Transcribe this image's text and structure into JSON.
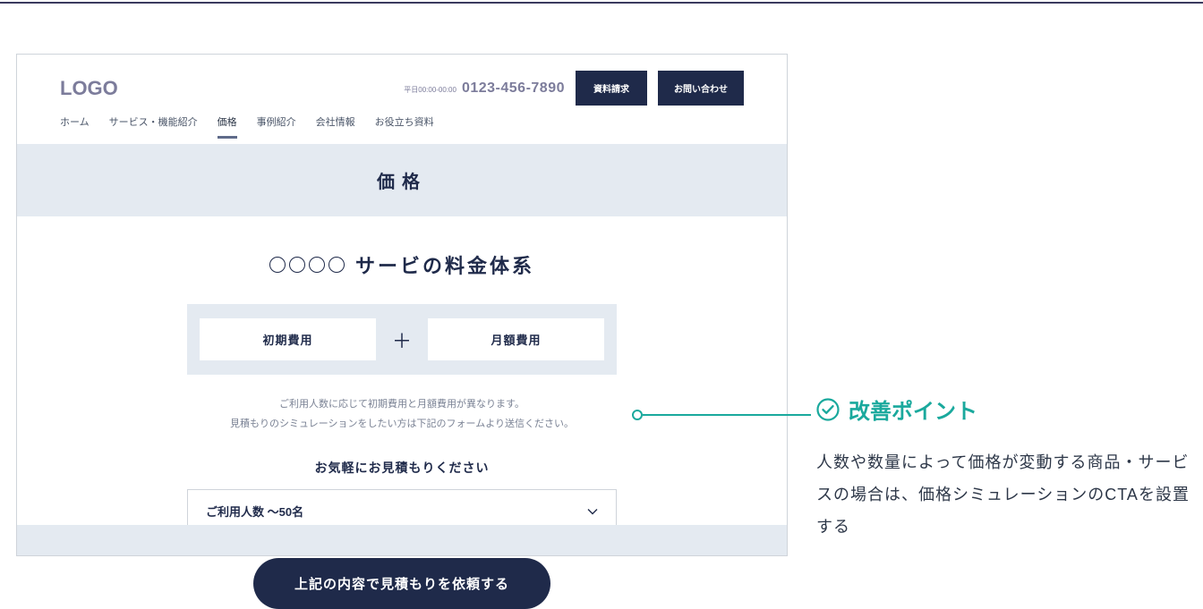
{
  "header": {
    "logo": "LOGO",
    "phone_hours": "平日00:00-00:00",
    "phone_number": "0123-456-7890",
    "btn_request": "資料請求",
    "btn_contact": "お問い合わせ"
  },
  "nav": {
    "items": [
      "ホーム",
      "サービス・機能紹介",
      "価格",
      "事例紹介",
      "会社情報",
      "お役立ち資料"
    ],
    "active_index": 2
  },
  "page_title": "価格",
  "section": {
    "title_text": "サービの料金体系",
    "fee_initial": "初期費用",
    "fee_monthly": "月額費用",
    "desc_line1": "ご利用人数に応じて初期費用と月額費用が異なります。",
    "desc_line2": "見積もりのシミュレーションをしたい方は下記のフォームより送信ください。",
    "sub_heading": "お気軽にお見積もりください",
    "select_label": "ご利用人数  〜50名",
    "cta_label": "上記の内容で見積もりを依頼する"
  },
  "annotation": {
    "title": "改善ポイント",
    "body": "人数や数量によって価格が変動する商品・サービスの場合は、価格シミュレーションのCTAを設置する"
  }
}
